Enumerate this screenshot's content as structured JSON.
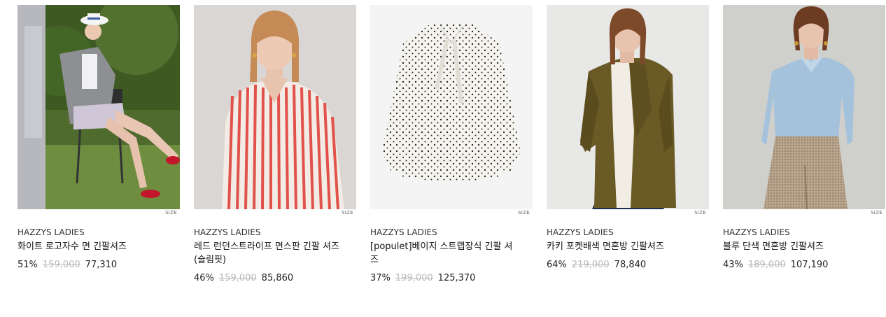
{
  "size_label": "SIZE",
  "products": [
    {
      "brand": "HAZZYS LADIES",
      "name": "화이트 로고자수 면 긴팔셔즈",
      "discount": "51%",
      "original_price": "159,000",
      "sale_price": "77,310"
    },
    {
      "brand": "HAZZYS LADIES",
      "name": "레드 런던스트라이프 면스판 긴팔 셔즈(슬림핏)",
      "discount": "46%",
      "original_price": "159,000",
      "sale_price": "85,860"
    },
    {
      "brand": "HAZZYS LADIES",
      "name": "[populet]베이지 스트랩장식 긴팔 셔즈",
      "discount": "37%",
      "original_price": "199,000",
      "sale_price": "125,370"
    },
    {
      "brand": "HAZZYS LADIES",
      "name": "카키 포켓배색 면혼방 긴팔셔즈",
      "discount": "64%",
      "original_price": "219,000",
      "sale_price": "78,840"
    },
    {
      "brand": "HAZZYS LADIES",
      "name": "블루 단색 면혼방 긴팔셔즈",
      "discount": "43%",
      "original_price": "189,000",
      "sale_price": "107,190"
    }
  ]
}
